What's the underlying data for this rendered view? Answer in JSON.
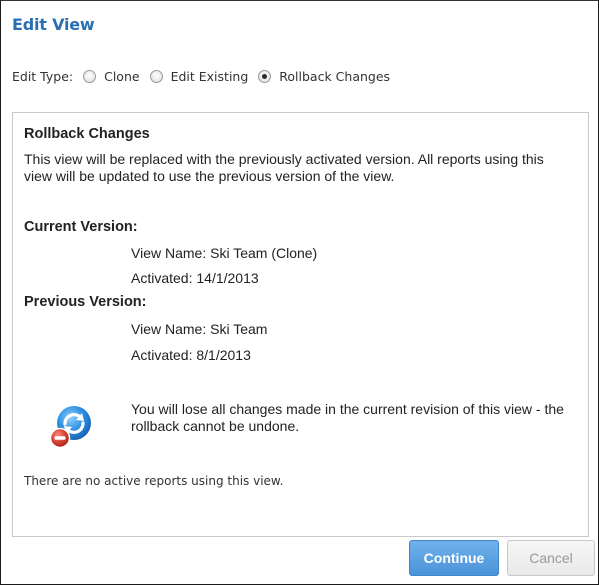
{
  "dialog": {
    "title": "Edit View"
  },
  "edit_type": {
    "label": "Edit Type:",
    "options": [
      {
        "label": "Clone",
        "checked": false
      },
      {
        "label": "Edit Existing",
        "checked": false
      },
      {
        "label": "Rollback Changes",
        "checked": true
      }
    ]
  },
  "rollback": {
    "title": "Rollback Changes",
    "description": "This view will be replaced with the previously activated version. All reports using this view will be updated to use the previous version of the view.",
    "current": {
      "heading": "Current Version:",
      "view_name": "View Name: Ski Team (Clone)",
      "activated": "Activated: 14/1/2013"
    },
    "previous": {
      "heading": "Previous Version:",
      "view_name": "View Name: Ski Team",
      "activated": "Activated: 8/1/2013"
    },
    "warning_icon": "rollback-warning-icon",
    "warning": "You will lose all changes made in the current revision of this view - the rollback cannot be undone.",
    "note": "There are no active reports using this view."
  },
  "buttons": {
    "continue": "Continue",
    "cancel": "Cancel"
  },
  "colors": {
    "title": "#2a6fb4",
    "primary_button": "#4b93d8",
    "icon_blue": "#2b8fe0",
    "icon_red": "#d23b2b"
  }
}
